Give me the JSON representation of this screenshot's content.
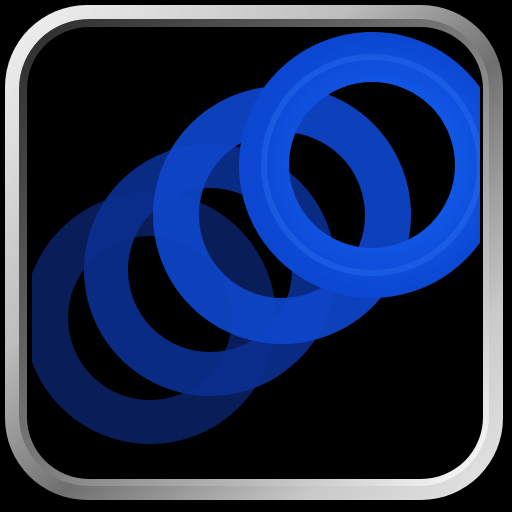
{
  "app_icon": {
    "icon_name": "overlapping-rings-icon",
    "colors": {
      "background": "#000000",
      "frame_light": "#f2f2f2",
      "frame_mid": "#a6a6a6",
      "frame_dark": "#3a3a3a",
      "ring_bright": "#1565ff",
      "ring_mid": "#0d47c7",
      "ring_dark": "#0a2f85",
      "ring_darkest": "#061a52"
    }
  }
}
